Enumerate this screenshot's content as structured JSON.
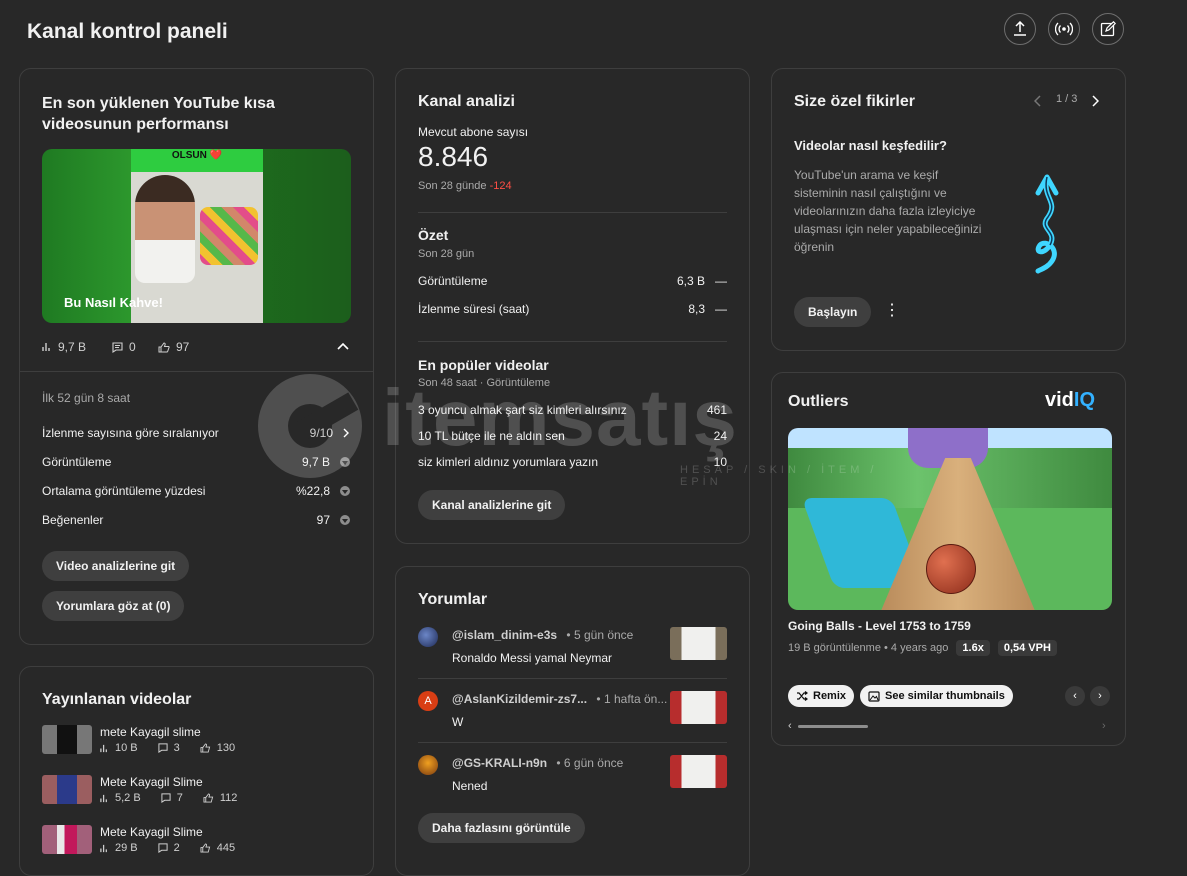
{
  "header": {
    "title": "Kanal kontrol paneli",
    "upload_icon": "upload-icon",
    "live_icon": "broadcast-icon",
    "create_icon": "edit-icon"
  },
  "shorts_card": {
    "title": "En son yüklenen YouTube kısa videosunun performansı",
    "thumbnail_top_text": "OLSUN ❤️",
    "thumbnail_caption": "Bu Nasıl Kahve!",
    "views": "9,7 B",
    "comments": "0",
    "likes": "97",
    "period": "İlk 52 gün 8 saat",
    "metrics": [
      {
        "label": "İzlenme sayısına göre sıralanıyor",
        "value": "9/10"
      },
      {
        "label": "Görüntüleme",
        "value": "9,7 B"
      },
      {
        "label": "Ortalama görüntüleme yüzdesi",
        "value": "%22,8"
      },
      {
        "label": "Beğenenler",
        "value": "97"
      }
    ],
    "btn_video_analytics": "Video analizlerine git",
    "btn_comments": "Yorumlara göz at (0)"
  },
  "published": {
    "title": "Yayınlanan videolar",
    "items": [
      {
        "title": "mete Kayagil slime",
        "views": "10 B",
        "comments": "3",
        "likes": "130"
      },
      {
        "title": "Mete Kayagil Slime",
        "views": "5,2 B",
        "comments": "7",
        "likes": "112"
      },
      {
        "title": "Mete Kayagil Slime",
        "views": "29 B",
        "comments": "2",
        "likes": "445"
      }
    ]
  },
  "analytics": {
    "title": "Kanal analizi",
    "subs_label": "Mevcut abone sayısı",
    "subs_value": "8.846",
    "subs_change_label": "Son 28 günde",
    "subs_change": "-124",
    "summary_title": "Özet",
    "summary_period": "Son 28 gün",
    "summary_rows": [
      {
        "label": "Görüntüleme",
        "value": "6,3 B",
        "trend": "—"
      },
      {
        "label": "İzlenme süresi (saat)",
        "value": "8,3",
        "trend": "—"
      }
    ],
    "top_title": "En popüler videolar",
    "top_period": "Son 48 saat · Görüntüleme",
    "top_rows": [
      {
        "label": "3 oyuncu almak şart siz kimleri alırsınız",
        "value": "461"
      },
      {
        "label": "10 TL bütçe ile ne aldın sen",
        "value": "24"
      },
      {
        "label": "siz kimleri aldınız yorumlara yazın",
        "value": "10"
      }
    ],
    "btn": "Kanal analizlerine git"
  },
  "comments": {
    "title": "Yorumlar",
    "items": [
      {
        "author": "@islam_dinim-e3s",
        "time": "• 5 gün önce",
        "text": "Ronaldo Messi yamal Neymar",
        "avatar_letter": ""
      },
      {
        "author": "@AslanKizildemir-zs7...",
        "time": "• 1 hafta ön...",
        "text": "W",
        "avatar_letter": "A"
      },
      {
        "author": "@GS-KRALI-n9n",
        "time": "• 6 gün önce",
        "text": "Nened",
        "avatar_letter": ""
      }
    ],
    "btn": "Daha fazlasını görüntüle"
  },
  "ideas": {
    "title": "Size özel fikirler",
    "pager": "1 / 3",
    "headline": "Videolar nasıl keşfedilir?",
    "body": "YouTube'un arama ve keşif sisteminin nasıl çalıştığını ve videolarınızın daha fazla izleyiciye ulaşması için neler yapabileceğinizi öğrenin",
    "btn": "Başlayın"
  },
  "outliers": {
    "title": "Outliers",
    "brand_vid": "vid",
    "brand_iq": "IQ",
    "video_title": "Going Balls - Level 1753 to 1759",
    "video_meta": "19 B görüntülenme • 4 years ago",
    "multiplier": "1.6x",
    "vph": "0,54 VPH",
    "remix": "Remix",
    "similar": "See similar thumbnails"
  },
  "watermark": {
    "brand": "itemsatış",
    "tagline": "HESAP / SKIN / İTEM / EPİN"
  },
  "colors": {
    "accent_red": "#ff4e45",
    "vidiq_blue": "#33b1ff",
    "idea_cyan": "#3fd6ff"
  }
}
